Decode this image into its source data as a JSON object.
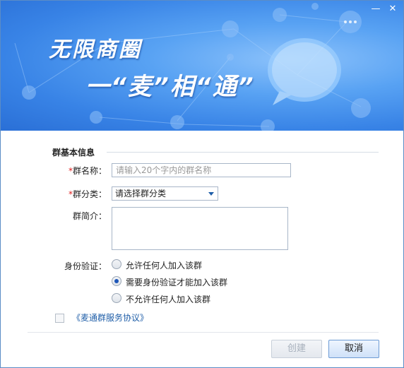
{
  "window": {
    "minimize_label": "—",
    "close_label": "✕"
  },
  "banner": {
    "slogan_line1": "无限商圈",
    "slogan_line2": "一“麦”相“通”"
  },
  "form": {
    "section_title": "群基本信息",
    "group_name": {
      "required_mark": "*",
      "label": "群名称：",
      "placeholder": "请输入20个字内的群名称"
    },
    "group_category": {
      "required_mark": "*",
      "label": "群分类：",
      "selected": "请选择群分类"
    },
    "group_intro": {
      "label": "群简介：",
      "value": ""
    },
    "verification": {
      "label": "身份验证：",
      "options": [
        {
          "label": "允许任何人加入该群",
          "selected": false
        },
        {
          "label": "需要身份验证才能加入该群",
          "selected": true
        },
        {
          "label": "不允许任何人加入该群",
          "selected": false
        }
      ]
    },
    "agreement": {
      "checked": false,
      "link_text": "《麦通群服务协议》"
    }
  },
  "buttons": {
    "create": "创建",
    "cancel": "取消"
  },
  "colors": {
    "accent": "#1f5ea8",
    "required": "#e02020",
    "banner": "#3883e6"
  }
}
